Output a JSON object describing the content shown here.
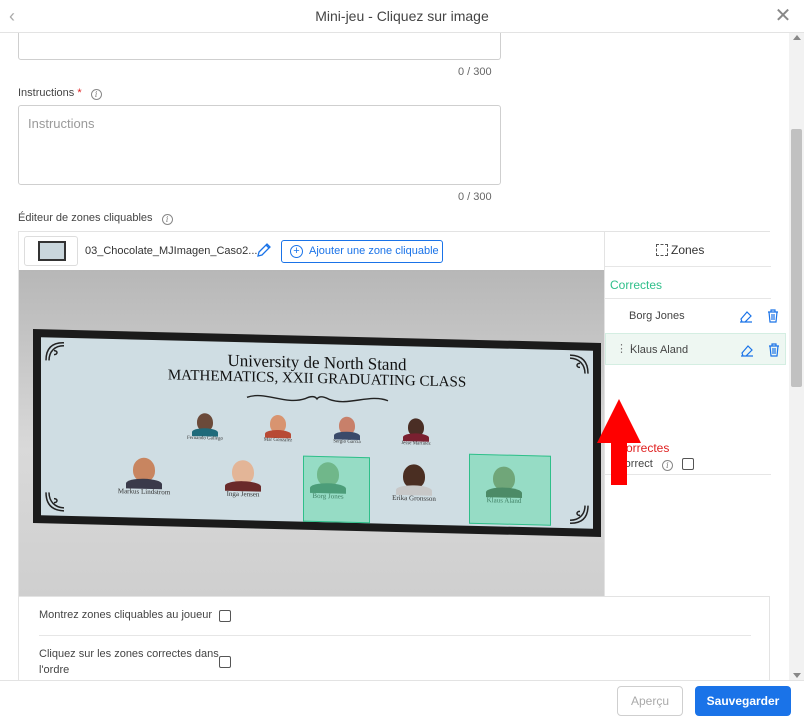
{
  "header": {
    "title": "Mini-jeu - Cliquez sur image"
  },
  "top_field": {
    "counter": "0 / 300"
  },
  "instructions": {
    "label": "Instructions",
    "required_mark": "*",
    "placeholder": "Instructions",
    "counter": "0 / 300"
  },
  "editor": {
    "label": "Éditeur de zones cliquables",
    "file_name": "03_Chocolate_MJImagen_Caso2...",
    "add_zone_label": "Ajouter une zone cliquable",
    "image": {
      "title_line1": "University de North Stand",
      "title_line2": "MATHEMATICS, XXII GRADUATING CLASS",
      "row1_names": [
        "Fernando Gallego",
        "Mar Gonzalez",
        "Sergio Garcia",
        "Jesse Martinez"
      ],
      "row2_names": [
        "Markus Lindstrom",
        "Inga Jensen",
        "Borg Jones",
        "Erika Gronsson",
        "Klaus Aland"
      ]
    }
  },
  "zones_panel": {
    "title": "Zones",
    "correct_label": "Correctes",
    "incorrect_label": "Incorrectes",
    "correct_zones": [
      {
        "name": "Borg Jones",
        "selected": false
      },
      {
        "name": "Klaus Aland",
        "selected": true
      }
    ],
    "incorrect_option_label": "Incorrect",
    "incorrect_checked": false
  },
  "options": {
    "show_zones_label": "Montrez zones cliquables au joueur",
    "show_zones_checked": false,
    "order_label_line1": "Cliquez sur les zones correctes dans",
    "order_label_line2": "l'ordre",
    "order_checked": false
  },
  "footer": {
    "preview_label": "Aperçu",
    "save_label": "Sauvegarder"
  },
  "colors": {
    "accent": "#1a73e8",
    "correct": "#2fbf8a",
    "incorrect": "#e02020",
    "annotation_arrow": "#ff0000"
  }
}
